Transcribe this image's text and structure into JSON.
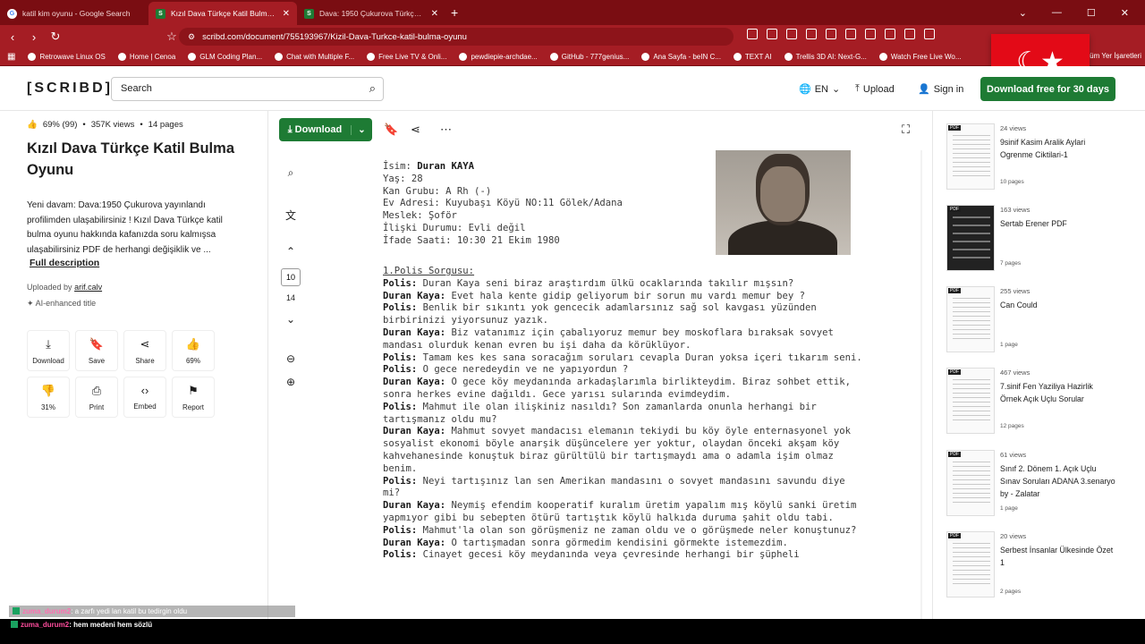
{
  "browser": {
    "tabs": [
      {
        "title": "katil kim oyunu - Google Search",
        "favicon": "google-icon",
        "active": false
      },
      {
        "title": "Kızıl Dava Türkçe Katil Bulma Oy",
        "favicon": "scribd-icon",
        "active": true
      },
      {
        "title": "Dava: 1950 Çukurova Türkçe Katil Bul",
        "favicon": "scribd-icon",
        "active": false
      }
    ],
    "url": "scribd.com/document/755193967/Kizil-Dava-Turkce-katil-bulma-oyunu",
    "bookmarks": [
      "Retrowave Linux OS",
      "Home | Cenoa",
      "GLM Coding Plan...",
      "Chat with Multiple F...",
      "Free Live TV & Onli...",
      "pewdiepie-archdae...",
      "GitHub - 777genius...",
      "Ana Sayfa - beIN C...",
      "TEXT AI",
      "Trellis 3D AI: Next-G...",
      "Watch Free Live Wo..."
    ],
    "bookmarks_right": "Tüm Yer İşaretleri",
    "theme_color": "#a51d24"
  },
  "header": {
    "logo": "[SCRIBD]",
    "search_placeholder": "Search",
    "language": "EN",
    "upload": "Upload",
    "signin": "Sign in",
    "cta": "Download free for 30 days"
  },
  "doc": {
    "rating": "69% (99)",
    "views": "357K views",
    "pages": "14 pages",
    "title": "Kızıl Dava Türkçe Katil Bulma Oyunu",
    "description": "Yeni davam: Dava:1950 Çukurova yayınlandı profilimden ulaşabilirsiniz ! Kızıl Dava Türkçe katil bulma oyunu hakkında kafanızda soru kalmışsa ulaşabilirsiniz PDF de herhangi değişiklik ve ...",
    "full_description": "Full description",
    "uploaded_by_label": "Uploaded by",
    "uploader": "arif.calv",
    "ai_title": "AI-enhanced title",
    "actions": [
      {
        "label": "Download",
        "icon": "download-icon",
        "glyph": "⤓"
      },
      {
        "label": "Save",
        "icon": "bookmark-icon",
        "glyph": "🔖"
      },
      {
        "label": "Share",
        "icon": "share-icon",
        "glyph": "⋖"
      },
      {
        "label": "69%",
        "icon": "thumbs-up-icon",
        "glyph": "👍"
      },
      {
        "label": "31%",
        "icon": "thumbs-down-icon",
        "glyph": "👎"
      },
      {
        "label": "Print",
        "icon": "print-icon",
        "glyph": "⎙"
      },
      {
        "label": "Embed",
        "icon": "embed-icon",
        "glyph": "‹›"
      },
      {
        "label": "Report",
        "icon": "flag-icon",
        "glyph": "⚑"
      }
    ]
  },
  "viewer": {
    "download_label": "Download",
    "current_page": "10",
    "total_pages": "14",
    "profile": [
      {
        "k": "İsim: ",
        "v": "Duran KAYA",
        "bold": true
      },
      {
        "k": "Yaş: ",
        "v": "28"
      },
      {
        "k": "Kan Grubu: ",
        "v": "A Rh (-)"
      },
      {
        "k": "Ev Adresi: ",
        "v": "Kuyubaşı Köyü NO:11 Gölek/Adana"
      },
      {
        "k": "Meslek: ",
        "v": "Şoför"
      },
      {
        "k": "İlişki Durumu: ",
        "v": "Evli değil"
      },
      {
        "k": "İfade Saati: ",
        "v": "10:30 21 Ekim 1980"
      }
    ],
    "section_header": "1.Polis Sorgusu:",
    "dialogue": [
      {
        "s": "Polis:",
        "t": " Duran Kaya seni biraz araştırdım ülkü ocaklarında takılır mışsın?"
      },
      {
        "s": "Duran Kaya:",
        "t": " Evet hala kente gidip geliyorum bir sorun mu vardı memur bey ?"
      },
      {
        "s": "Polis:",
        "t": " Benlik bir sıkıntı yok gencecik adamlarsınız sağ sol kavgası yüzünden birbirinizi yiyorsunuz yazık."
      },
      {
        "s": "Duran Kaya:",
        "t": " Biz vatanımız için çabalıyoruz memur bey moskoflara bıraksak sovyet mandası olurduk kenan evren bu işi daha da körüklüyor."
      },
      {
        "s": "Polis:",
        "t": " Tamam kes kes sana soracağım soruları cevapla Duran yoksa içeri tıkarım seni."
      },
      {
        "s": "Polis:",
        "t": " O gece neredeydin ve ne yapıyordun ?"
      },
      {
        "s": "Duran Kaya:",
        "t": " O gece köy meydanında arkadaşlarımla birlikteydim. Biraz sohbet ettik, sonra herkes evine dağıldı. Gece yarısı sularında evimdeydim."
      },
      {
        "s": "Polis:",
        "t": " Mahmut ile olan ilişkiniz nasıldı? Son zamanlarda onunla herhangi bir tartışmanız oldu mu?"
      },
      {
        "s": "Duran Kaya:",
        "t": " Mahmut sovyet mandacısı elemanın tekiydi bu köy öyle enternasyonel yok sosyalist ekonomi böyle anarşik düşüncelere yer yoktur, olaydan önceki akşam köy kahvehanesinde konuştuk biraz gürültülü bir tartışmaydı ama o adamla işim olmaz benim."
      },
      {
        "s": "Polis:",
        "t": " Neyi tartışınız lan sen Amerikan mandasını o sovyet mandasını savundu diye mi?"
      },
      {
        "s": "Duran Kaya:",
        "t": " Neymiş efendim kooperatif kuralım üretim yapalım mış köylü sanki üretim yapmıyor gibi bu sebepten ötürü tartıştık köylü halkıda duruma şahit oldu tabi."
      },
      {
        "s": "Polis:",
        "t": " Mahmut'la olan son görüşmeniz ne zaman oldu ve o görüşmede neler konuştunuz?"
      },
      {
        "s": "Duran Kaya:",
        "t": " O tartışmadan sonra görmedim kendisini görmekte istemezdim."
      },
      {
        "s": "Polis:",
        "t": " Cinayet gecesi köy meydanında veya çevresinde herhangi bir şüpheli"
      }
    ]
  },
  "related": [
    {
      "views": "24 views",
      "title": "9sinif Kasim Aralik Aylari Ogrenme Ciktilari-1",
      "pages": "10 pages",
      "dark": false
    },
    {
      "views": "163 views",
      "title": "Sertab Erener PDF",
      "pages": "7 pages",
      "dark": true
    },
    {
      "views": "255 views",
      "title": "Can Could",
      "pages": "1 page",
      "dark": false
    },
    {
      "views": "467 views",
      "title": "7.sinif Fen Yaziliya Hazirlik Örnek Açık Uçlu Sorular",
      "pages": "12 pages",
      "dark": false
    },
    {
      "views": "61 views",
      "title": "Sınıf 2. Dönem 1. Açık Uçlu Sınav Soruları ADANA 3.senaryo by - Zalatar",
      "pages": "1 page",
      "dark": false
    },
    {
      "views": "20 views",
      "title": "Serbest İnsanlar Ülkesinde Özet 1",
      "pages": "2 pages",
      "dark": false
    }
  ],
  "chat": [
    {
      "user": "zuma_durum2",
      "msg": ": a zarfı yedi lan katil bu tedirgin oldu"
    },
    {
      "user": "zuma_durum2",
      "msg": ": hem medeni hem sözlü"
    }
  ],
  "colors": {
    "brand_green": "#1e7b34",
    "browser_red": "#a51d24"
  }
}
